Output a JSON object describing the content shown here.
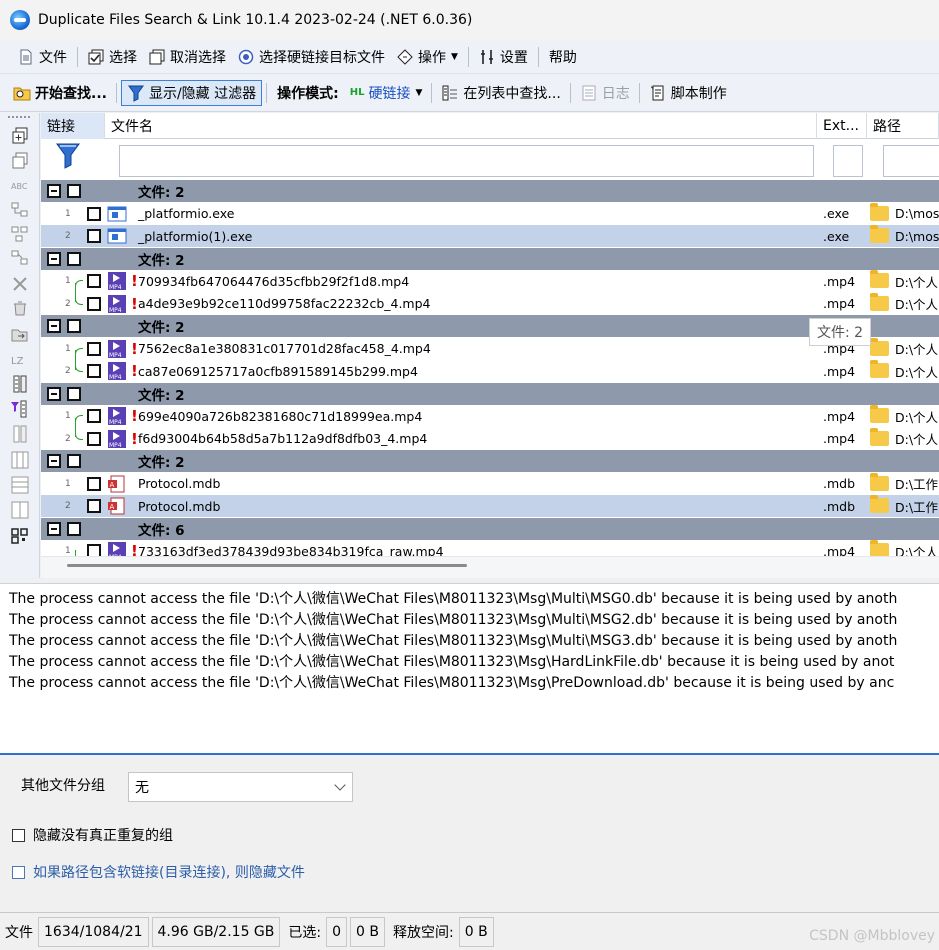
{
  "window": {
    "title": "Duplicate Files Search & Link 10.1.4 2023-02-24 (.NET 6.0.36)"
  },
  "menu": [
    {
      "label": "文件",
      "icon": "document-icon"
    },
    {
      "label": "选择",
      "icon": "check-select-icon"
    },
    {
      "label": "取消选择",
      "icon": "uncheck-icon"
    },
    {
      "label": "选择硬链接目标文件",
      "icon": "hardlink-target-icon"
    },
    {
      "label": "操作",
      "icon": "diamond-action-icon",
      "dropdown": true
    },
    {
      "label": "设置",
      "icon": "settings-icon"
    },
    {
      "label": "帮助",
      "icon": ""
    }
  ],
  "toolbar": {
    "start_search": "开始查找...",
    "toggle_filter": "显示/隐藏 过滤器",
    "mode_label": "操作模式:",
    "mode_badge": "HL",
    "mode_value": "硬链接",
    "find_in_list": "在列表中查找...",
    "log": "日志",
    "script": "脚本制作"
  },
  "columns": {
    "link": "链接",
    "filename": "文件名",
    "ext": "Ext...",
    "path": "路径"
  },
  "groups": [
    {
      "title": "文件: 2",
      "linked": false,
      "files": [
        {
          "num": "1",
          "name": "_platformio.exe",
          "ext": ".exe",
          "path": "D:\\mos",
          "type": "exe",
          "warn": false,
          "selected": false
        },
        {
          "num": "2",
          "name": "_platformio(1).exe",
          "ext": ".exe",
          "path": "D:\\mos",
          "type": "exe",
          "warn": false,
          "selected": true
        }
      ]
    },
    {
      "title": "文件: 2",
      "linked": true,
      "files": [
        {
          "num": "1",
          "name": "709934fb647064476d35cfbb29f2f1d8.mp4",
          "ext": ".mp4",
          "path": "D:\\个人",
          "type": "mp4",
          "warn": true,
          "selected": false
        },
        {
          "num": "2",
          "name": "a4de93e9b92ce110d99758fac22232cb_4.mp4",
          "ext": ".mp4",
          "path": "D:\\个人",
          "type": "mp4",
          "warn": true,
          "selected": false
        }
      ]
    },
    {
      "title": "文件: 2",
      "linked": true,
      "files": [
        {
          "num": "1",
          "name": "7562ec8a1e380831c017701d28fac458_4.mp4",
          "ext": ".mp4",
          "path": "D:\\个人",
          "type": "mp4",
          "warn": true,
          "selected": false
        },
        {
          "num": "2",
          "name": "ca87e069125717a0cfb891589145b299.mp4",
          "ext": ".mp4",
          "path": "D:\\个人",
          "type": "mp4",
          "warn": true,
          "selected": false
        }
      ]
    },
    {
      "title": "文件: 2",
      "linked": true,
      "files": [
        {
          "num": "1",
          "name": "699e4090a726b82381680c71d18999ea.mp4",
          "ext": ".mp4",
          "path": "D:\\个人",
          "type": "mp4",
          "warn": true,
          "selected": false
        },
        {
          "num": "2",
          "name": "f6d93004b64b58d5a7b112a9df8dfb03_4.mp4",
          "ext": ".mp4",
          "path": "D:\\个人",
          "type": "mp4",
          "warn": true,
          "selected": false
        }
      ]
    },
    {
      "title": "文件: 2",
      "linked": false,
      "files": [
        {
          "num": "1",
          "name": "Protocol.mdb",
          "ext": ".mdb",
          "path": "D:\\工作",
          "type": "mdb",
          "warn": false,
          "selected": false
        },
        {
          "num": "2",
          "name": "Protocol.mdb",
          "ext": ".mdb",
          "path": "D:\\工作",
          "type": "mdb",
          "warn": false,
          "selected": true
        }
      ]
    },
    {
      "title": "文件: 6",
      "linked": true,
      "files": [
        {
          "num": "1",
          "name": "733163df3ed378439d93be834b319fca_raw.mp4",
          "ext": ".mp4",
          "path": "D:\\个人",
          "type": "mp4",
          "warn": true,
          "selected": false
        }
      ]
    }
  ],
  "tooltip": "文件: 2",
  "log_lines": [
    "The process cannot access the file 'D:\\个人\\微信\\WeChat Files\\M8011323\\Msg\\Multi\\MSG0.db' because it is being used by anoth",
    "The process cannot access the file 'D:\\个人\\微信\\WeChat Files\\M8011323\\Msg\\Multi\\MSG2.db' because it is being used by anoth",
    "The process cannot access the file 'D:\\个人\\微信\\WeChat Files\\M8011323\\Msg\\Multi\\MSG3.db' because it is being used by anoth",
    "The process cannot access the file 'D:\\个人\\微信\\WeChat Files\\M8011323\\Msg\\HardLinkFile.db' because it is being used by anot",
    "The process cannot access the file 'D:\\个人\\微信\\WeChat Files\\M8011323\\Msg\\PreDownload.db' because it is being used by anc"
  ],
  "options": {
    "other_group_label": "其他文件分组",
    "other_group_value": "无",
    "hide_not_dup": "隐藏没有真正重复的组",
    "hide_symlink": "如果路径包含软链接(目录连接), 则隐藏文件"
  },
  "status": {
    "files_label": "文件",
    "counts": "1634/1084/21",
    "size": "4.96 GB/2.15 GB",
    "selected_label": "已选:",
    "selected_count": "0",
    "selected_size": "0 B",
    "free_label": "释放空间:",
    "free_value": "0 B"
  },
  "watermark": "CSDN @Mbblovey",
  "colors": {
    "group_row": "#8e9aac",
    "selected_row": "#c3d2e8",
    "accent": "#2f6fd0",
    "warn": "#d80000",
    "link_bracket": "#29a329"
  }
}
